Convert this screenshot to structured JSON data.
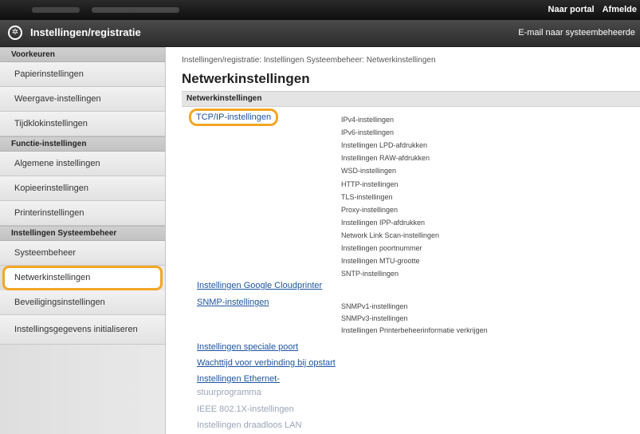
{
  "topbar": {
    "portal_link": "Naar portal",
    "cut_link": "Afmelde"
  },
  "header": {
    "title": "Instellingen/registratie",
    "email_link": "E-mail naar systeembeheerde"
  },
  "sidebar": {
    "groups": [
      {
        "heading": "Voorkeuren",
        "items": [
          "Papierinstellingen",
          "Weergave-instellingen",
          "Tijdklokinstellingen"
        ]
      },
      {
        "heading": "Functie-instellingen",
        "items": [
          "Algemene instellingen",
          "Kopieerinstellingen",
          "Printerinstellingen"
        ]
      },
      {
        "heading": "Instellingen Systeembeheer",
        "items": [
          "Systeembeheer",
          "Netwerkinstellingen",
          "Beveiligingsinstellingen",
          "Instellingsgegevens initialiseren"
        ]
      }
    ]
  },
  "main": {
    "breadcrumb": "Instellingen/registratie: Instellingen Systeembeheer: Netwerkinstellingen",
    "title": "Netwerkinstellingen",
    "section": "Netwerkinstellingen",
    "tcpip": "TCP/IP-instellingen",
    "tcpip_sub": [
      "IPv4-instellingen",
      "IPv6-instellingen",
      "Instellingen LPD-afdrukken",
      "Instellingen RAW-afdrukken",
      "WSD-instellingen",
      "HTTP-instellingen",
      "TLS-instellingen",
      "Proxy-instellingen",
      "Instellingen IPP-afdrukken",
      "Network Link Scan-instellingen",
      "Instellingen poortnummer",
      "Instellingen MTU-grootte",
      "SNTP-instellingen"
    ],
    "google": "Instellingen Google Cloudprinter",
    "snmp": "SNMP-instellingen",
    "snmp_sub": [
      "SNMPv1-instellingen",
      "SNMPv3-instellingen",
      "Instellingen Printerbeheerinformatie verkrijgen"
    ],
    "dedicated_port": "Instellingen speciale poort",
    "wait_time": "Wachttijd voor verbinding bij opstart",
    "ethernet_1": "Instellingen Ethernet-",
    "ethernet_2": "stuurprogramma",
    "ieee": "IEEE 802.1X-instellingen",
    "wireless": "Instellingen draadloos LAN"
  }
}
